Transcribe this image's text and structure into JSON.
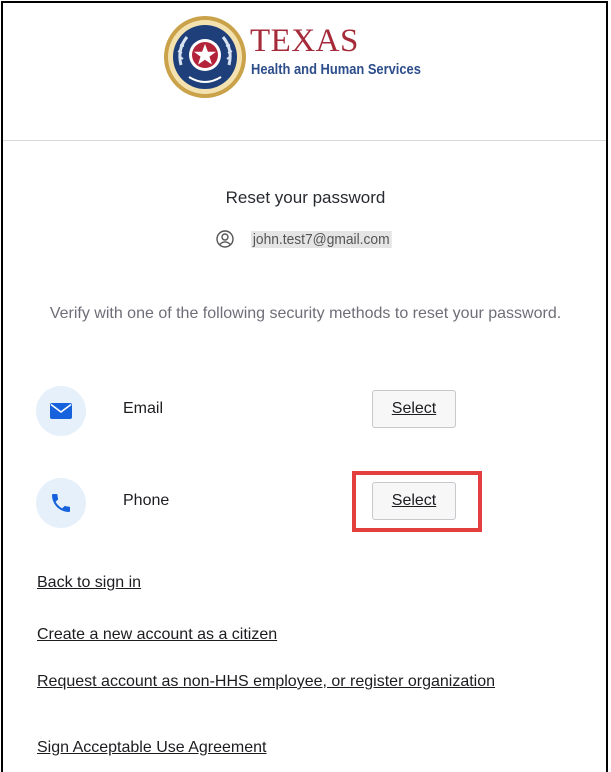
{
  "logo": {
    "line1": "TEXAS",
    "line2": "Health and Human Services"
  },
  "page": {
    "title": "Reset your password",
    "identifier": "john.test7@gmail.com",
    "instruction": "Verify with one of the following security methods to reset your password."
  },
  "methods": [
    {
      "label": "Email",
      "button": "Select",
      "icon": "envelope-icon"
    },
    {
      "label": "Phone",
      "button": "Select",
      "icon": "phone-icon"
    }
  ],
  "links": {
    "back": "Back to sign in",
    "create": "Create a new account as a citizen",
    "request": "Request account as non-HHS employee, or register organization",
    "sign": "Sign Acceptable Use Agreement"
  },
  "colors": {
    "highlight": "#e43f3f",
    "brand_red": "#a52a3a",
    "brand_blue": "#2d4e8a",
    "icon_blue": "#1662dd"
  }
}
